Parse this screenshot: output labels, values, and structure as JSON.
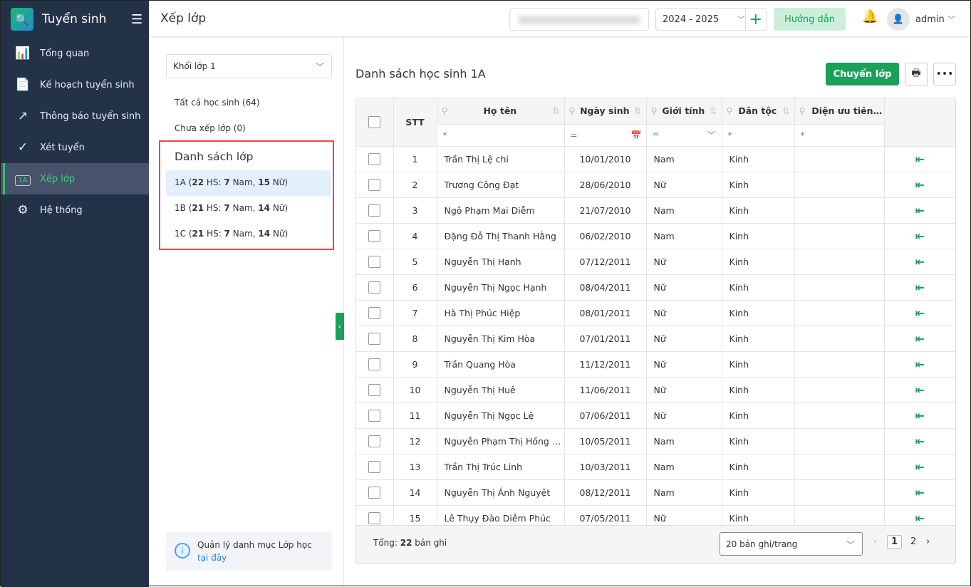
{
  "app": {
    "title": "Tuyển sinh"
  },
  "sidebar": {
    "items": [
      {
        "label": "Tổng quan",
        "icon": "bar-chart-icon"
      },
      {
        "label": "Kế hoạch tuyển sinh",
        "icon": "document-icon"
      },
      {
        "label": "Thông báo tuyển sinh",
        "icon": "trend-icon"
      },
      {
        "label": "Xét tuyển",
        "icon": "check-circle-icon"
      },
      {
        "label": "Xếp lớp",
        "icon": "class-icon",
        "badge": "1A"
      },
      {
        "label": "Hệ thống",
        "icon": "gear-icon"
      }
    ]
  },
  "header": {
    "title": "Xếp lớp",
    "year": "2024 - 2025",
    "guide": "Hướng dẫn",
    "user": "admin"
  },
  "left": {
    "grade": "Khối lớp 1",
    "all": "Tất cả học sinh (64)",
    "unassigned": "Chưa xếp lớp (0)",
    "class_list_title": "Danh sách lớp",
    "classes": [
      {
        "name": "1A",
        "total": "22",
        "nam": "7",
        "nu": "15"
      },
      {
        "name": "1B",
        "total": "21",
        "nam": "7",
        "nu": "14"
      },
      {
        "name": "1C",
        "total": "21",
        "nam": "7",
        "nu": "14"
      }
    ],
    "hs": "HS:",
    "nam_label": "Nam,",
    "nu_label": "Nữ)",
    "info_text": "Quản lý danh mục Lớp học",
    "info_link": "tại đây"
  },
  "main": {
    "title": "Danh sách học sinh 1A",
    "move_button": "Chuyển lớp",
    "columns": [
      "STT",
      "Họ tên",
      "Ngày sinh",
      "Giới tính",
      "Dân tộc",
      "Diện ưu tiên, Khu vực"
    ],
    "filters": [
      "*",
      "=",
      "=",
      "*",
      "*"
    ],
    "rows": [
      [
        "1",
        "Trần Thị Lệ chi",
        "10/01/2010",
        "Nam",
        "Kinh"
      ],
      [
        "2",
        "Trương Công Đạt",
        "28/06/2010",
        "Nữ",
        "Kinh"
      ],
      [
        "3",
        "Ngô Phạm Mai Diễm",
        "21/07/2010",
        "Nam",
        "Kinh"
      ],
      [
        "4",
        "Đặng Đỗ Thị Thanh Hằng",
        "06/02/2010",
        "Nam",
        "Kinh"
      ],
      [
        "5",
        "Nguyễn Thị Hạnh",
        "07/12/2011",
        "Nữ",
        "Kinh"
      ],
      [
        "6",
        "Nguyễn Thị Ngọc Hạnh",
        "08/04/2011",
        "Nữ",
        "Kinh"
      ],
      [
        "7",
        "Hà Thị Phúc Hiệp",
        "08/01/2011",
        "Nữ",
        "Kinh"
      ],
      [
        "8",
        "Nguyễn Thị Kim Hòa",
        "07/01/2011",
        "Nữ",
        "Kinh"
      ],
      [
        "9",
        "Trần Quang Hòa",
        "11/12/2011",
        "Nữ",
        "Kinh"
      ],
      [
        "10",
        "Nguyễn Thị Huê",
        "11/06/2011",
        "Nữ",
        "Kinh"
      ],
      [
        "11",
        "Nguyễn Thị Ngọc Lệ",
        "07/06/2011",
        "Nữ",
        "Kinh"
      ],
      [
        "12",
        "Nguyễn Phạm Thị Hồng Nhung",
        "10/05/2011",
        "Nam",
        "Kinh"
      ],
      [
        "13",
        "Trần Thị Trúc Linh",
        "10/03/2011",
        "Nam",
        "Kinh"
      ],
      [
        "14",
        "Nguyễn Thị Ánh Nguyệt",
        "08/12/2011",
        "Nam",
        "Kinh"
      ],
      [
        "15",
        "Lê Thụy Đào Diễm Phúc",
        "07/05/2011",
        "Nữ",
        "Kinh"
      ]
    ],
    "total_label": "Tổng:",
    "total": "22",
    "total_suffix": "bản ghi",
    "page_size": "20 bản ghi/trang",
    "pages": [
      "1",
      "2"
    ]
  }
}
